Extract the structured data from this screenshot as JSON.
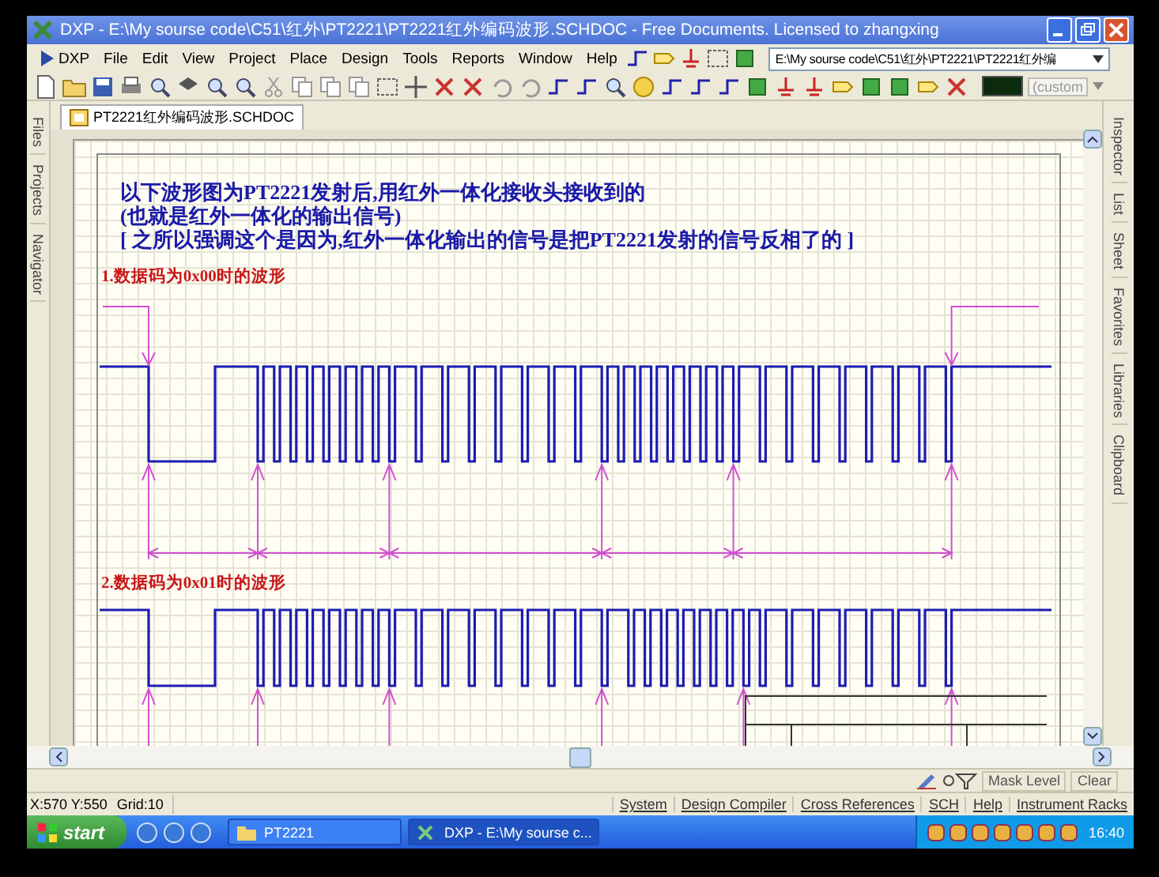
{
  "window": {
    "title": "DXP - E:\\My sourse code\\C51\\红外\\PT2221\\PT2221红外编码波形.SCHDOC - Free Documents. Licensed to zhangxing"
  },
  "menu": [
    "DXP",
    "File",
    "Edit",
    "View",
    "Project",
    "Place",
    "Design",
    "Tools",
    "Reports",
    "Window",
    "Help"
  ],
  "path_dropdown": {
    "value": "E:\\My sourse code\\C51\\红外\\PT2221\\PT2221红外编"
  },
  "color_dropdown": {
    "value": "(custom"
  },
  "left_panel_tabs": [
    "Files",
    "Projects",
    "Navigator"
  ],
  "document_tabs": [
    {
      "label": "PT2221红外编码波形.SCHDOC",
      "selected": true
    }
  ],
  "sheet": {
    "intro_lines": [
      "以下波形图为PT2221发射后,用红外一体化接收头接收到的",
      "(也就是红外一体化的输出信号)",
      "[ 之所以强调这个是因为,红外一体化输出的信号是把PT2221发射的信号反相了的  ]"
    ],
    "sections": [
      {
        "heading": "1.数据码为0x00时的波形"
      },
      {
        "heading": "2.数据码为0x01时的波形"
      }
    ]
  },
  "right_panel_tabs": [
    "Inspector",
    "List",
    "Sheet",
    "Favorites",
    "Libraries",
    "Clipboard"
  ],
  "mask_bar": {
    "buttons": [
      "Mask Level",
      "Clear"
    ]
  },
  "status_bar": {
    "position": "X:570 Y:550",
    "grid": "Grid:10",
    "panels": [
      "System",
      "Design Compiler",
      "Cross References",
      "SCH",
      "Help",
      "Instrument Racks"
    ]
  },
  "taskbar": {
    "start": "start",
    "tasks": [
      {
        "label": "PT2221",
        "selected": false
      },
      {
        "label": "DXP - E:\\My sourse c...",
        "selected": true
      }
    ],
    "clock": "16:40"
  }
}
